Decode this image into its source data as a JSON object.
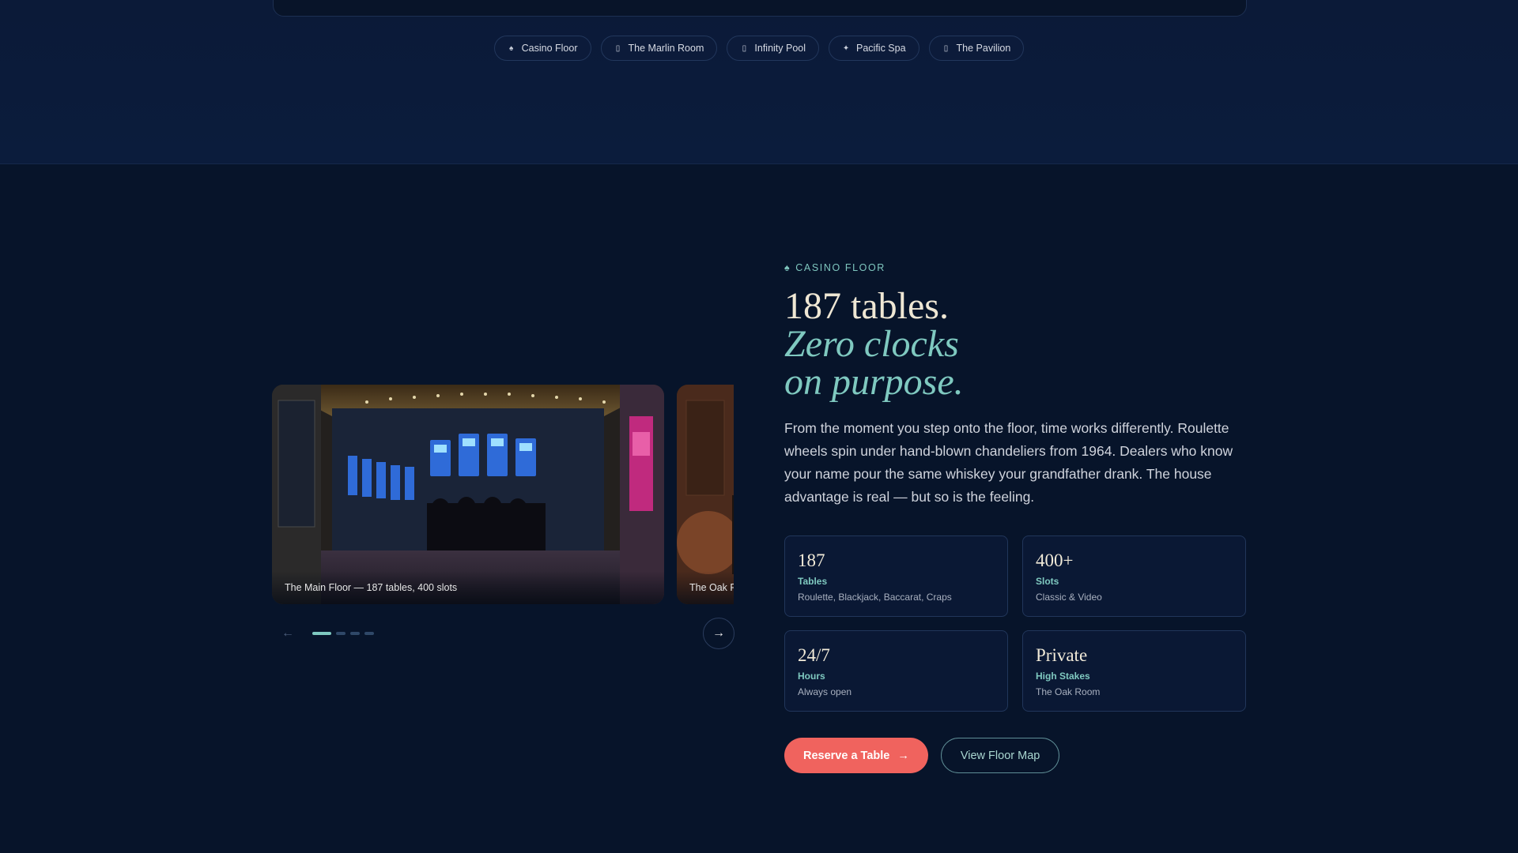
{
  "nav": {
    "chips": [
      {
        "icon": "spade-icon",
        "glyph": "♠",
        "label": "Casino Floor"
      },
      {
        "icon": "glass-icon",
        "glyph": "▯",
        "label": "The Marlin Room"
      },
      {
        "icon": "pool-icon",
        "glyph": "▯",
        "label": "Infinity Pool"
      },
      {
        "icon": "sparkle-icon",
        "glyph": "✦",
        "label": "Pacific Spa"
      },
      {
        "icon": "pavilion-icon",
        "glyph": "▯",
        "label": "The Pavilion"
      }
    ]
  },
  "carousel": {
    "slides": [
      {
        "caption": "The Main Floor — 187 tables, 400 slots"
      },
      {
        "caption": "The Oak R"
      }
    ],
    "dot_count": 4,
    "active_index": 0,
    "prev_glyph": "←",
    "next_glyph": "→"
  },
  "section": {
    "eyebrow_icon": "♠",
    "eyebrow": "CASINO FLOOR",
    "headline_1": "187 tables.",
    "headline_2": "Zero clocks",
    "headline_3": "on purpose.",
    "body": "From the moment you step onto the floor, time works differently. Roulette wheels spin under hand-blown chandeliers from 1964. Dealers who know your name pour the same whiskey your grandfather drank. The house advantage is real — but so is the feeling."
  },
  "stats": [
    {
      "value": "187",
      "label": "Tables",
      "sub": "Roulette, Blackjack, Baccarat, Craps"
    },
    {
      "value": "400+",
      "label": "Slots",
      "sub": "Classic & Video"
    },
    {
      "value": "24/7",
      "label": "Hours",
      "sub": "Always open"
    },
    {
      "value": "Private",
      "label": "High Stakes",
      "sub": "The Oak Room"
    }
  ],
  "cta": {
    "primary": "Reserve a Table",
    "primary_arrow": "→",
    "secondary": "View Floor Map"
  },
  "colors": {
    "accent_teal": "#7fc9c0",
    "accent_coral": "#f0635e",
    "background": "#07142a"
  }
}
